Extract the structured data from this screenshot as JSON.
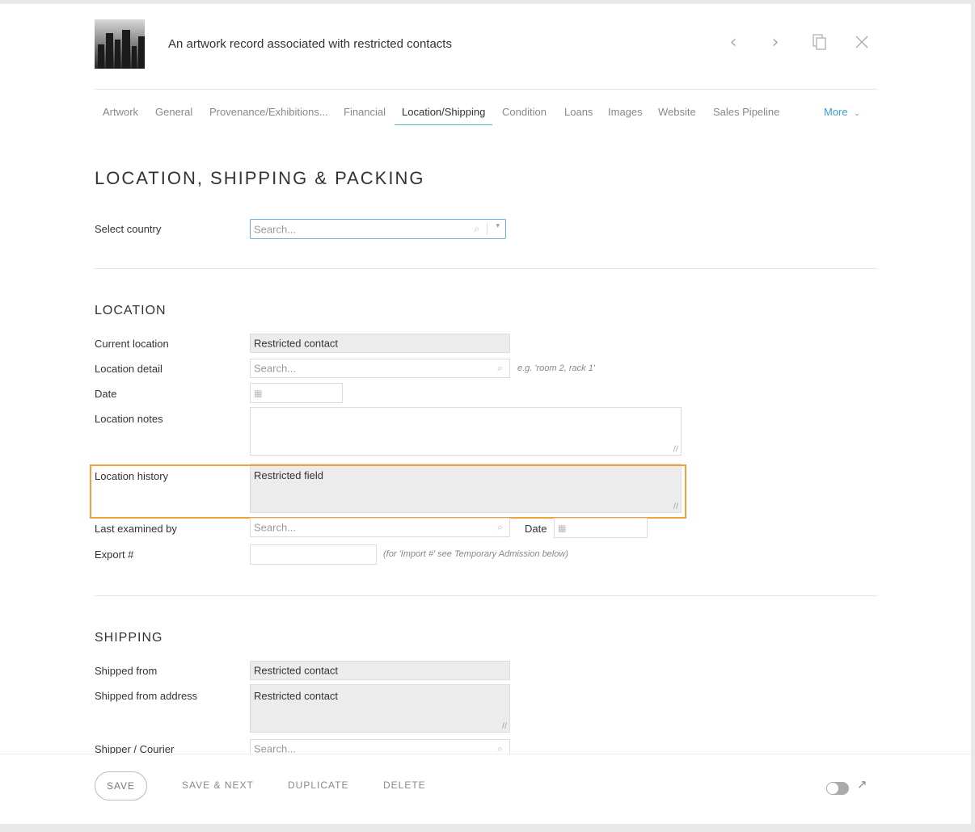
{
  "header": {
    "title": "An artwork record associated with restricted contacts",
    "icons": [
      "chevron-left-icon",
      "chevron-right-icon",
      "duplicate-icon",
      "close-icon"
    ]
  },
  "tabs": [
    {
      "label": "Artwork"
    },
    {
      "label": "General"
    },
    {
      "label": "Provenance/Exhibitions..."
    },
    {
      "label": "Financial"
    },
    {
      "label": "Location/Shipping",
      "active": true
    },
    {
      "label": "Condition"
    },
    {
      "label": "Loans"
    },
    {
      "label": "Images"
    },
    {
      "label": "Website"
    },
    {
      "label": "Sales Pipeline"
    }
  ],
  "more_label": "More",
  "page_title": "LOCATION, SHIPPING & PACKING",
  "country": {
    "label": "Select country",
    "placeholder": "Search..."
  },
  "location": {
    "heading": "LOCATION",
    "current_location": {
      "label": "Current location",
      "value": "Restricted contact"
    },
    "location_detail": {
      "label": "Location detail",
      "placeholder": "Search...",
      "hint": "e.g. 'room 2, rack 1'"
    },
    "date": {
      "label": "Date"
    },
    "location_notes": {
      "label": "Location notes"
    },
    "location_history": {
      "label": "Location history",
      "value": "Restricted field"
    },
    "last_examined_by": {
      "label": "Last examined by",
      "placeholder": "Search...",
      "date_label": "Date"
    },
    "export": {
      "label": "Export #",
      "hint": "(for 'Import #' see Temporary Admission below)"
    }
  },
  "shipping": {
    "heading": "SHIPPING",
    "shipped_from": {
      "label": "Shipped from",
      "value": "Restricted contact"
    },
    "shipped_from_address": {
      "label": "Shipped from address",
      "value": "Restricted contact"
    },
    "shipper_courier": {
      "label": "Shipper / Courier",
      "placeholder": "Search..."
    }
  },
  "footer": {
    "save": "SAVE",
    "save_next": "SAVE & NEXT",
    "duplicate": "DUPLICATE",
    "delete": "DELETE"
  },
  "colors": {
    "accent": "#3a9bd5",
    "highlight": "#f0a03c",
    "tab_underline": "#5bb3c5"
  }
}
